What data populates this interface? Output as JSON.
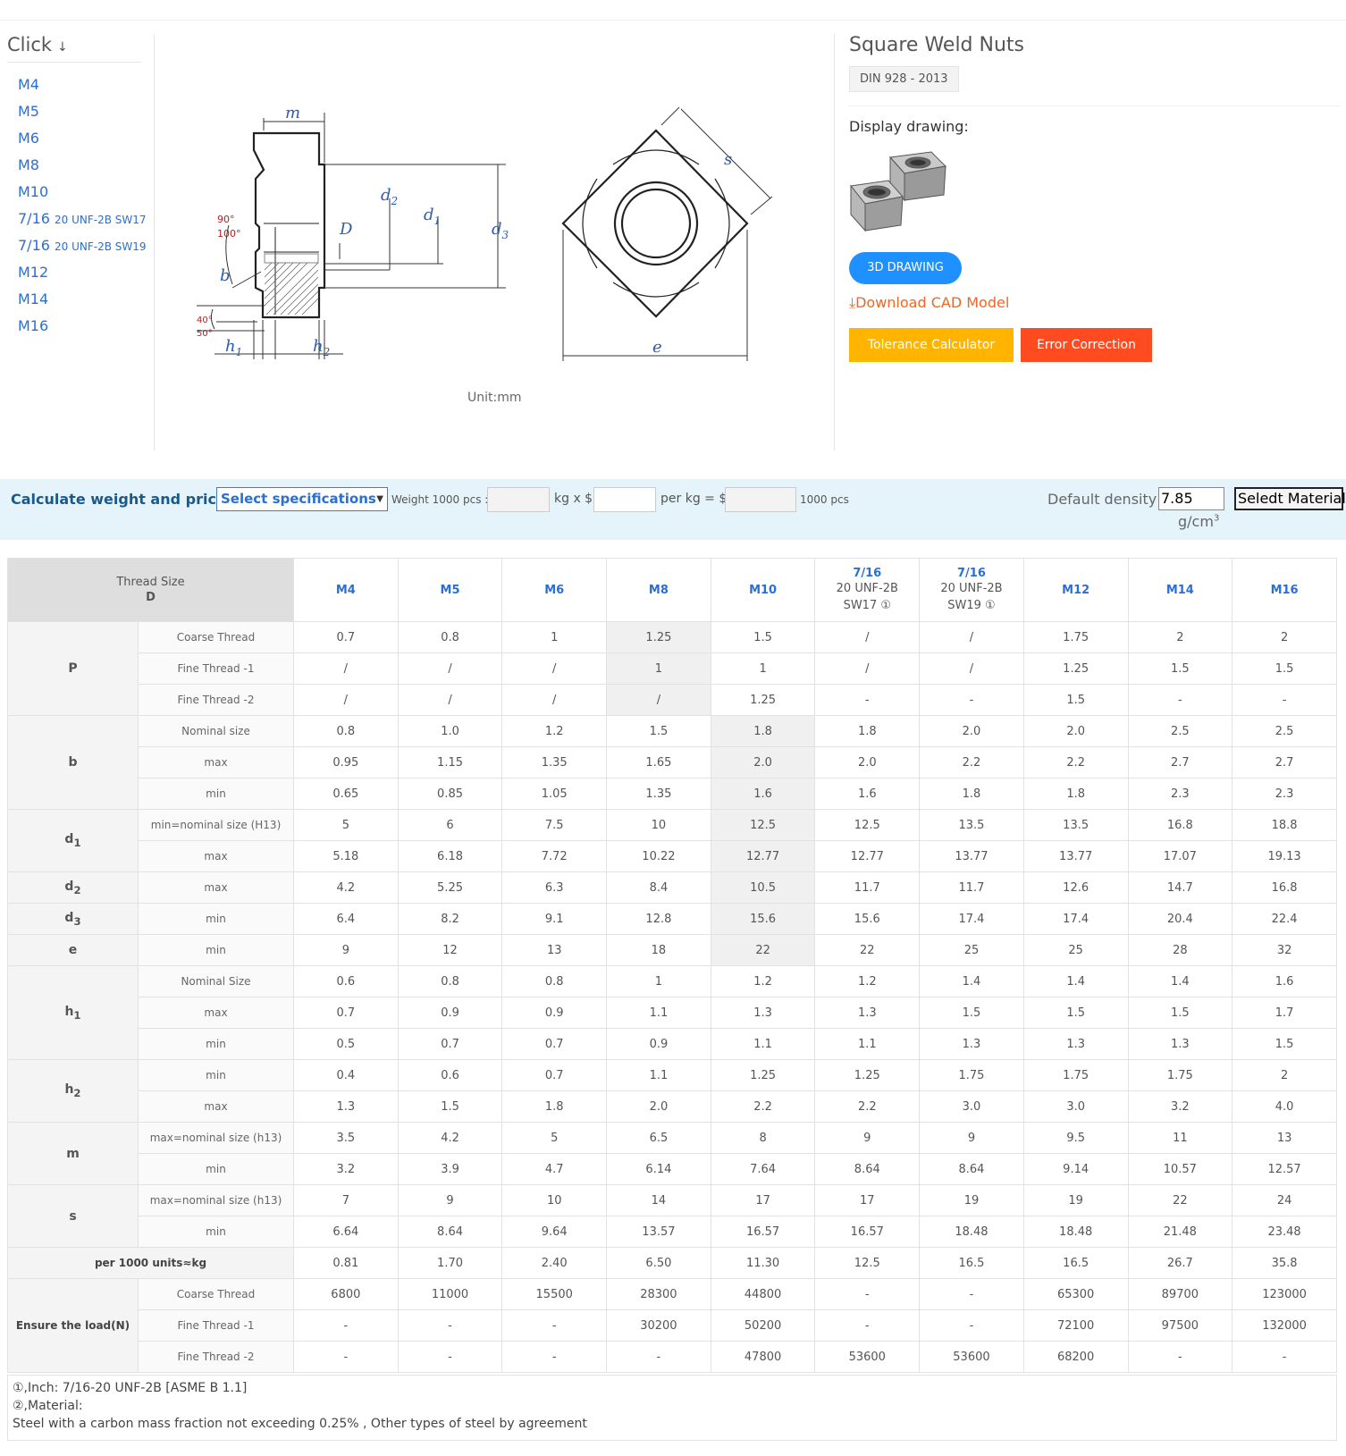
{
  "sidebar": {
    "title": "Click",
    "arrow": "↓",
    "items": [
      {
        "main": "M4",
        "small": ""
      },
      {
        "main": "M5",
        "small": ""
      },
      {
        "main": "M6",
        "small": ""
      },
      {
        "main": "M8",
        "small": ""
      },
      {
        "main": "M10",
        "small": ""
      },
      {
        "main": "7/16",
        "small": "20 UNF-2B SW17"
      },
      {
        "main": "7/16",
        "small": "20 UNF-2B SW19"
      },
      {
        "main": "M12",
        "small": ""
      },
      {
        "main": "M14",
        "small": ""
      },
      {
        "main": "M16",
        "small": ""
      }
    ]
  },
  "drawing": {
    "unit": "Unit:mm",
    "labels": {
      "m": "m",
      "d2": "d",
      "d1": "d",
      "d3": "d",
      "D": "D",
      "b": "b",
      "h1": "h",
      "h2": "h",
      "s": "s",
      "e": "e",
      "a90": "90°",
      "a100": "100°",
      "a40": "40°",
      "a50": "50°",
      "sub1": "1",
      "sub2": "2",
      "sub3": "3"
    }
  },
  "product": {
    "title": "Square Weld Nuts",
    "standard": "DIN 928 - 2013",
    "display_label": "Display drawing:",
    "btn_3d": "3D DRAWING",
    "download_cad": "Download CAD Model",
    "btn_tolerance": "Tolerance Calculator",
    "btn_error": "Error Correction"
  },
  "calc": {
    "title": "Calculate weight and price.",
    "select": "Select specifications",
    "weight_label": "Weight 1000 pcs :",
    "kg_label": "kg x $",
    "perkg_label": "per kg = $",
    "pcs_label": "1000 pcs",
    "density_label": "Default density",
    "density_value": "7.85",
    "material_btn": "Seledt Material",
    "unit": "g/cm",
    "unit_sup": "3"
  },
  "table": {
    "corner": {
      "line1": "Thread Size",
      "line2": "D"
    },
    "columns": [
      {
        "main": "M4",
        "sub": []
      },
      {
        "main": "M5",
        "sub": []
      },
      {
        "main": "M6",
        "sub": []
      },
      {
        "main": "M8",
        "sub": []
      },
      {
        "main": "M10",
        "sub": []
      },
      {
        "main": "7/16",
        "sub": [
          "20 UNF-2B",
          "SW17 ①"
        ]
      },
      {
        "main": "7/16",
        "sub": [
          "20 UNF-2B",
          "SW19 ①"
        ]
      },
      {
        "main": "M12",
        "sub": []
      },
      {
        "main": "M14",
        "sub": []
      },
      {
        "main": "M16",
        "sub": []
      }
    ],
    "groups": [
      {
        "param": "P",
        "rows": [
          {
            "label": "Coarse Thread",
            "values": [
              "0.7",
              "0.8",
              "1",
              "1.25",
              "1.5",
              "/",
              "/",
              "1.75",
              "2",
              "2"
            ]
          },
          {
            "label": "Fine Thread -1",
            "values": [
              "/",
              "/",
              "/",
              "1",
              "1",
              "/",
              "/",
              "1.25",
              "1.5",
              "1.5"
            ]
          },
          {
            "label": "Fine Thread -2",
            "values": [
              "/",
              "/",
              "/",
              "/",
              "1.25",
              "-",
              "-",
              "1.5",
              "-",
              "-"
            ]
          }
        ]
      },
      {
        "param": "b",
        "rows": [
          {
            "label": "Nominal size",
            "values": [
              "0.8",
              "1.0",
              "1.2",
              "1.5",
              "1.8",
              "1.8",
              "2.0",
              "2.0",
              "2.5",
              "2.5"
            ]
          },
          {
            "label": "max",
            "values": [
              "0.95",
              "1.15",
              "1.35",
              "1.65",
              "2.0",
              "2.0",
              "2.2",
              "2.2",
              "2.7",
              "2.7"
            ]
          },
          {
            "label": "min",
            "values": [
              "0.65",
              "0.85",
              "1.05",
              "1.35",
              "1.6",
              "1.6",
              "1.8",
              "1.8",
              "2.3",
              "2.3"
            ]
          }
        ]
      },
      {
        "param": "d",
        "sub": "1",
        "rows": [
          {
            "label": "min=nominal size (H13)",
            "values": [
              "5",
              "6",
              "7.5",
              "10",
              "12.5",
              "12.5",
              "13.5",
              "13.5",
              "16.8",
              "18.8"
            ]
          },
          {
            "label": "max",
            "values": [
              "5.18",
              "6.18",
              "7.72",
              "10.22",
              "12.77",
              "12.77",
              "13.77",
              "13.77",
              "17.07",
              "19.13"
            ]
          }
        ]
      },
      {
        "param": "d",
        "sub": "2",
        "rows": [
          {
            "label": "max",
            "values": [
              "4.2",
              "5.25",
              "6.3",
              "8.4",
              "10.5",
              "11.7",
              "11.7",
              "12.6",
              "14.7",
              "16.8"
            ]
          }
        ]
      },
      {
        "param": "d",
        "sub": "3",
        "rows": [
          {
            "label": "min",
            "values": [
              "6.4",
              "8.2",
              "9.1",
              "12.8",
              "15.6",
              "15.6",
              "17.4",
              "17.4",
              "20.4",
              "22.4"
            ]
          }
        ]
      },
      {
        "param": "e",
        "rows": [
          {
            "label": "min",
            "values": [
              "9",
              "12",
              "13",
              "18",
              "22",
              "22",
              "25",
              "25",
              "28",
              "32"
            ]
          }
        ]
      },
      {
        "param": "h",
        "sub": "1",
        "rows": [
          {
            "label": "Nominal Size",
            "values": [
              "0.6",
              "0.8",
              "0.8",
              "1",
              "1.2",
              "1.2",
              "1.4",
              "1.4",
              "1.4",
              "1.6"
            ]
          },
          {
            "label": "max",
            "values": [
              "0.7",
              "0.9",
              "0.9",
              "1.1",
              "1.3",
              "1.3",
              "1.5",
              "1.5",
              "1.5",
              "1.7"
            ]
          },
          {
            "label": "min",
            "values": [
              "0.5",
              "0.7",
              "0.7",
              "0.9",
              "1.1",
              "1.1",
              "1.3",
              "1.3",
              "1.3",
              "1.5"
            ]
          }
        ]
      },
      {
        "param": "h",
        "sub": "2",
        "rows": [
          {
            "label": "min",
            "values": [
              "0.4",
              "0.6",
              "0.7",
              "1.1",
              "1.25",
              "1.25",
              "1.75",
              "1.75",
              "1.75",
              "2"
            ]
          },
          {
            "label": "max",
            "values": [
              "1.3",
              "1.5",
              "1.8",
              "2.0",
              "2.2",
              "2.2",
              "3.0",
              "3.0",
              "3.2",
              "4.0"
            ]
          }
        ]
      },
      {
        "param": "m",
        "rows": [
          {
            "label": "max=nominal size (h13)",
            "values": [
              "3.5",
              "4.2",
              "5",
              "6.5",
              "8",
              "9",
              "9",
              "9.5",
              "11",
              "13"
            ]
          },
          {
            "label": "min",
            "values": [
              "3.2",
              "3.9",
              "4.7",
              "6.14",
              "7.64",
              "8.64",
              "8.64",
              "9.14",
              "10.57",
              "12.57"
            ]
          }
        ]
      },
      {
        "param": "s",
        "rows": [
          {
            "label": "max=nominal size (h13)",
            "values": [
              "7",
              "9",
              "10",
              "14",
              "17",
              "17",
              "19",
              "19",
              "22",
              "24"
            ]
          },
          {
            "label": "min",
            "values": [
              "6.64",
              "8.64",
              "9.64",
              "13.57",
              "16.57",
              "16.57",
              "18.48",
              "18.48",
              "21.48",
              "23.48"
            ]
          }
        ]
      }
    ],
    "weight_row": {
      "label": "per 1000 units≈kg",
      "values": [
        "0.81",
        "1.70",
        "2.40",
        "6.50",
        "11.30",
        "12.5",
        "16.5",
        "16.5",
        "26.7",
        "35.8"
      ]
    },
    "load_group": {
      "param": "Ensure the load(N)",
      "rows": [
        {
          "label": "Coarse Thread",
          "values": [
            "6800",
            "11000",
            "15500",
            "28300",
            "44800",
            "-",
            "-",
            "65300",
            "89700",
            "123000"
          ]
        },
        {
          "label": "Fine Thread -1",
          "values": [
            "-",
            "-",
            "-",
            "30200",
            "50200",
            "-",
            "-",
            "72100",
            "97500",
            "132000"
          ]
        },
        {
          "label": "Fine Thread -2",
          "values": [
            "-",
            "-",
            "-",
            "-",
            "47800",
            "53600",
            "53600",
            "68200",
            "-",
            "-"
          ]
        }
      ]
    }
  },
  "notes": [
    "①,Inch:  7/16-20 UNF-2B [ASME B 1.1]",
    "②,Material:",
    "Steel with a carbon mass fraction not exceeding 0.25% , Other types of steel by agreement"
  ]
}
